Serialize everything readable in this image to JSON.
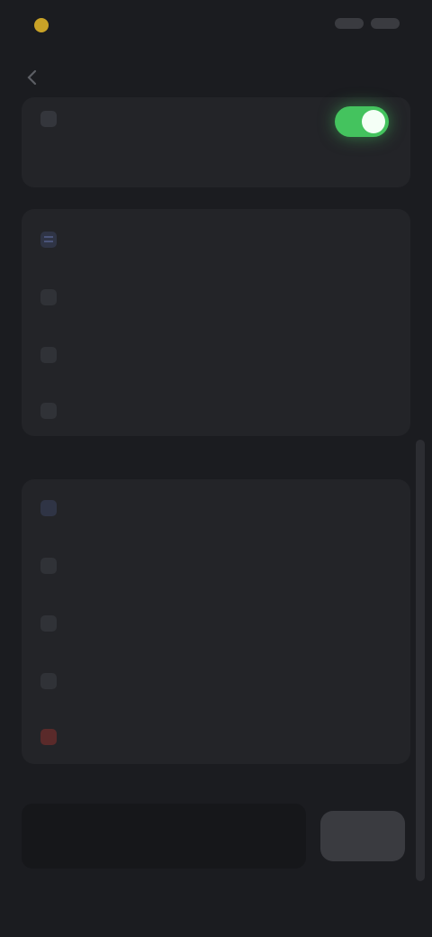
{
  "status_bar": {
    "brand": ""
  },
  "header": {
    "title": ""
  },
  "top_card": {
    "label": "",
    "description": "",
    "toggle_on": true
  },
  "menu_group_1": [
    {
      "label": "",
      "icon": "list-icon"
    },
    {
      "label": "",
      "icon": "item-icon"
    },
    {
      "label": "",
      "icon": "item-icon"
    },
    {
      "label": "",
      "icon": "item-icon"
    }
  ],
  "menu_group_2": [
    {
      "label": "",
      "icon": "item-icon"
    },
    {
      "label": "",
      "icon": "item-icon"
    },
    {
      "label": "",
      "icon": "item-icon"
    },
    {
      "label": "",
      "icon": "item-icon"
    },
    {
      "label": "",
      "icon": "delete-icon"
    }
  ],
  "bottom": {
    "input_placeholder": "",
    "button_label": ""
  },
  "colors": {
    "background": "#1b1c20",
    "card": "#232428",
    "toggle_on": "#44c35e",
    "danger": "#c0392b",
    "logo": "#c9a227"
  }
}
